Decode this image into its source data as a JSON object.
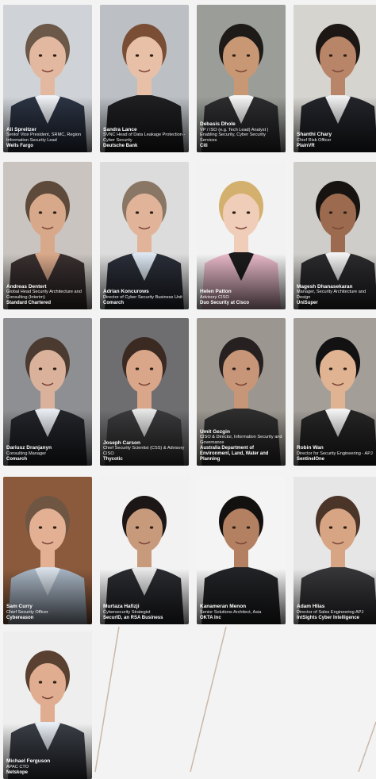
{
  "speakers": [
    {
      "name": "Ali Spreitzer",
      "title": "Senior Vice President, SRMC, Region Information Security Lead",
      "company": "Wells Fargo",
      "colors": {
        "bg": "#cfd3d8",
        "skin": "#e3b8a0",
        "hair": "#6b5848",
        "shirt": "#eef1f5",
        "suit": "#2c3444"
      }
    },
    {
      "name": "Sandra Lance",
      "title": "SVNC Head of Data Leakage Protection - Cyber Security",
      "company": "Deutsche Bank",
      "colors": {
        "bg": "#bcc0c5",
        "skin": "#e8c0a8",
        "hair": "#7a4e34",
        "shirt": "#1f1f22",
        "suit": "#1f1f22"
      }
    },
    {
      "name": "Debasis Dhole",
      "title": "VP / ISO (e.g. Tech Lead) Analyst | Enabling Security, Cyber Security Services",
      "company": "Citi",
      "colors": {
        "bg": "#9a9d98",
        "skin": "#c89874",
        "hair": "#1d1a18",
        "shirt": "#f4f4f4",
        "suit": "#2d2d30"
      }
    },
    {
      "name": "Shanthi Chary",
      "title": "Chief Risk Officer",
      "company": "PlainVR",
      "colors": {
        "bg": "#d6d4cf",
        "skin": "#b98568",
        "hair": "#1c1614",
        "shirt": "#f0f0f0",
        "suit": "#24252b"
      }
    },
    {
      "name": "Andreas Dentert",
      "title": "Global Head Security Architecture and Consulting (Interim)",
      "company": "Standard Chartered",
      "colors": {
        "bg": "#c9c4bf",
        "skin": "#d8a88a",
        "hair": "#5d4a3a",
        "shirt": "#d8a88a",
        "suit": "#3a3030"
      }
    },
    {
      "name": "Adrian Koncurows",
      "title": "Director of Cyber Security Business Unit",
      "company": "Comarch",
      "colors": {
        "bg": "#dcdcdc",
        "skin": "#e1b49a",
        "hair": "#8a7664",
        "shirt": "#dce6f0",
        "suit": "#2a2e38"
      }
    },
    {
      "name": "Helen Patton",
      "title": "Advisory CISO",
      "company": "Duo Security at Cisco",
      "colors": {
        "bg": "#f2f2f2",
        "skin": "#f0cdb8",
        "hair": "#d3b06e",
        "shirt": "#1c1c1c",
        "suit": "#e7b8c8"
      }
    },
    {
      "name": "Magesh Dhanasekaran",
      "title": "Manager, Security Architecture and Design",
      "company": "UniSuper",
      "colors": {
        "bg": "#cfcdc9",
        "skin": "#9c6a4e",
        "hair": "#161311",
        "shirt": "#f2f2f2",
        "suit": "#2b2b2e"
      }
    },
    {
      "name": "Dariusz Dranjanyn",
      "title": "Consulting Manager",
      "company": "Comarch",
      "colors": {
        "bg": "#8d8f92",
        "skin": "#dab29c",
        "hair": "#4a3a30",
        "shirt": "#e8ecf2",
        "suit": "#23252a"
      }
    },
    {
      "name": "Joseph Carson",
      "title": "Chief Security Scientist (CSS) & Advisory CISO",
      "company": "Thycotic",
      "colors": {
        "bg": "#6e6e70",
        "skin": "#d9a68a",
        "hair": "#3a2a22",
        "shirt": "#e6e6e6",
        "suit": "#3a3a3c"
      }
    },
    {
      "name": "Umit Gezgin",
      "title": "CISO & Director, Information Security and Governance",
      "company": "Australia Department of Environment, Land, Water and Planning",
      "colors": {
        "bg": "#9b9790",
        "skin": "#c79577",
        "hair": "#262020",
        "shirt": "#2e2e2e",
        "suit": "#2e2e2e"
      }
    },
    {
      "name": "Robin Wan",
      "title": "Director for Security Engineering - APJ",
      "company": "SentinelOne",
      "colors": {
        "bg": "#a49e99",
        "skin": "#e0b392",
        "hair": "#121212",
        "shirt": "#f3f3f3",
        "suit": "#252525"
      }
    },
    {
      "name": "Sam Curry",
      "title": "Chief Security Officer",
      "company": "Cybereason",
      "colors": {
        "bg": "#8b5a3c",
        "skin": "#e4b094",
        "hair": "#6f5642",
        "shirt": "#d7dfe8",
        "suit": "#a7b4c3"
      }
    },
    {
      "name": "Murtaza Hafizji",
      "title": "Cybersecurity Strategist",
      "company": "SecurID, an RSA Business",
      "colors": {
        "bg": "#f2f2f2",
        "skin": "#c89a7c",
        "hair": "#1c1716",
        "shirt": "#e9e9e9",
        "suit": "#2a2b30"
      }
    },
    {
      "name": "Kanameran Menon",
      "title": "Senior Solutions Architect, Asia",
      "company": "OKTA Inc",
      "colors": {
        "bg": "#f4f4f4",
        "skin": "#b48062",
        "hair": "#131110",
        "shirt": "#222326",
        "suit": "#222326"
      }
    },
    {
      "name": "Adam Hlias",
      "title": "Director of Sales Engineering APJ",
      "company": "IntSights Cyber Intelligence",
      "colors": {
        "bg": "#e6e6e6",
        "skin": "#d8a584",
        "hair": "#4b3428",
        "shirt": "#36363a",
        "suit": "#36363a"
      }
    },
    {
      "name": "Michael Ferguson",
      "title": "APAC CTO",
      "company": "Netskope",
      "colors": {
        "bg": "#eeeeee",
        "skin": "#e0ad90",
        "hair": "#5a4030",
        "shirt": "#e8eef5",
        "suit": "#3a3e46"
      }
    }
  ]
}
